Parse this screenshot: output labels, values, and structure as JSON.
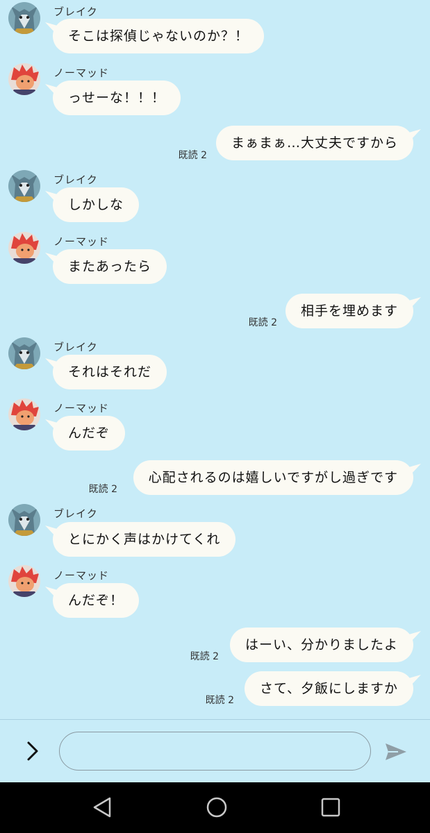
{
  "users": {
    "blake": {
      "name": "ブレイク",
      "avatar_icon": "wolf-avatar-icon"
    },
    "nomad": {
      "name": "ノーマッド",
      "avatar_icon": "red-hair-avatar-icon"
    }
  },
  "messages": [
    {
      "type": "in",
      "sender": "ブレイク",
      "text": "そこは探偵じゃないのか？！"
    },
    {
      "type": "in",
      "sender": "ノーマッド",
      "text": "っせーな！！！"
    },
    {
      "type": "out",
      "read": "既読 2",
      "text": "まぁまぁ…大丈夫ですから"
    },
    {
      "type": "in",
      "sender": "ブレイク",
      "text": "しかしな"
    },
    {
      "type": "in",
      "sender": "ノーマッド",
      "text": "またあったら"
    },
    {
      "type": "out",
      "read": "既読 2",
      "text": "相手を埋めます"
    },
    {
      "type": "in",
      "sender": "ブレイク",
      "text": "それはそれだ"
    },
    {
      "type": "in",
      "sender": "ノーマッド",
      "text": "んだぞ"
    },
    {
      "type": "out",
      "read": "既読 2",
      "text": "心配されるのは嬉しいですがし過ぎです"
    },
    {
      "type": "in",
      "sender": "ブレイク",
      "text": "とにかく声はかけてくれ"
    },
    {
      "type": "in",
      "sender": "ノーマッド",
      "text": "んだぞ！"
    },
    {
      "type": "out",
      "read": "既読 2",
      "text": "はーい、分かりましたよ"
    },
    {
      "type": "out",
      "read": "既読 2",
      "text": "さて、夕飯にしますか"
    }
  ],
  "input": {
    "expand_icon": "chevron-right-icon",
    "text_value": "",
    "placeholder": "",
    "send_icon": "send-icon"
  },
  "navbar": {
    "back_icon": "triangle-back-icon",
    "home_icon": "circle-home-icon",
    "recents_icon": "square-recents-icon"
  },
  "colors": {
    "background": "#c8ecf8",
    "bubble": "#fbfaf3",
    "navbar": "#000000"
  }
}
